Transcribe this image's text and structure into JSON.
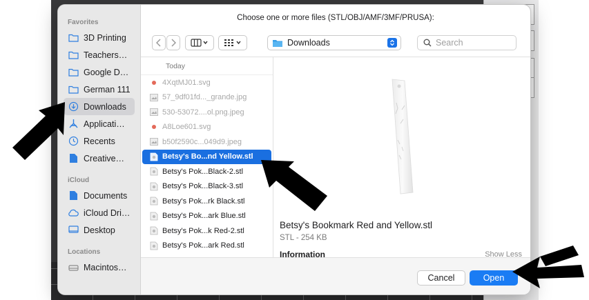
{
  "dialog": {
    "title": "Choose one or more files (STL/OBJ/AMF/3MF/PRUSA):"
  },
  "sidebar": {
    "favorites_label": "Favorites",
    "favorites": [
      {
        "label": "3D Printing",
        "icon": "folder-icon"
      },
      {
        "label": "Teachers…",
        "icon": "folder-icon"
      },
      {
        "label": "Google D…",
        "icon": "folder-icon"
      },
      {
        "label": "German 111",
        "icon": "folder-icon"
      },
      {
        "label": "Downloads",
        "icon": "download-icon",
        "selected": true
      },
      {
        "label": "Applicati…",
        "icon": "applications-icon"
      },
      {
        "label": "Recents",
        "icon": "clock-icon"
      },
      {
        "label": "Creative…",
        "icon": "document-icon"
      }
    ],
    "icloud_label": "iCloud",
    "icloud": [
      {
        "label": "Documents",
        "icon": "document-icon"
      },
      {
        "label": "iCloud Dri…",
        "icon": "cloud-icon"
      },
      {
        "label": "Desktop",
        "icon": "desktop-icon"
      }
    ],
    "locations_label": "Locations",
    "locations": [
      {
        "label": "Macintos…",
        "icon": "disk-icon"
      }
    ]
  },
  "toolbar": {
    "location": "Downloads",
    "search_placeholder": "Search"
  },
  "files": {
    "group_label": "Today",
    "items": [
      {
        "name": "4XqtMJ01.svg",
        "dim": true
      },
      {
        "name": "57_9df01fd..._grande.jpg",
        "dim": true
      },
      {
        "name": "530-53072....ol.png.jpeg",
        "dim": true
      },
      {
        "name": "A8Loe601.svg",
        "dim": true
      },
      {
        "name": "b50f2590c...049d9.jpeg",
        "dim": true
      },
      {
        "name": "Betsy's Bo...nd Yellow.stl",
        "selected": true
      },
      {
        "name": "Betsy's Pok...Black-2.stl"
      },
      {
        "name": "Betsy's Pok...Black-3.stl"
      },
      {
        "name": "Betsy's Pok...rk Black.stl"
      },
      {
        "name": "Betsy's Pok...ark Blue.stl"
      },
      {
        "name": "Betsy's Pok...k Red-2.stl"
      },
      {
        "name": "Betsy's Pok...ark Red.stl"
      }
    ]
  },
  "preview": {
    "filename": "Betsy's Bookmark Red and Yellow.stl",
    "meta": "STL - 254 KB",
    "info_label": "Information",
    "show_less": "Show Less"
  },
  "buttons": {
    "cancel": "Cancel",
    "open": "Open"
  },
  "colors": {
    "accent": "#1a7cf4",
    "selection": "#1a6fe0"
  }
}
